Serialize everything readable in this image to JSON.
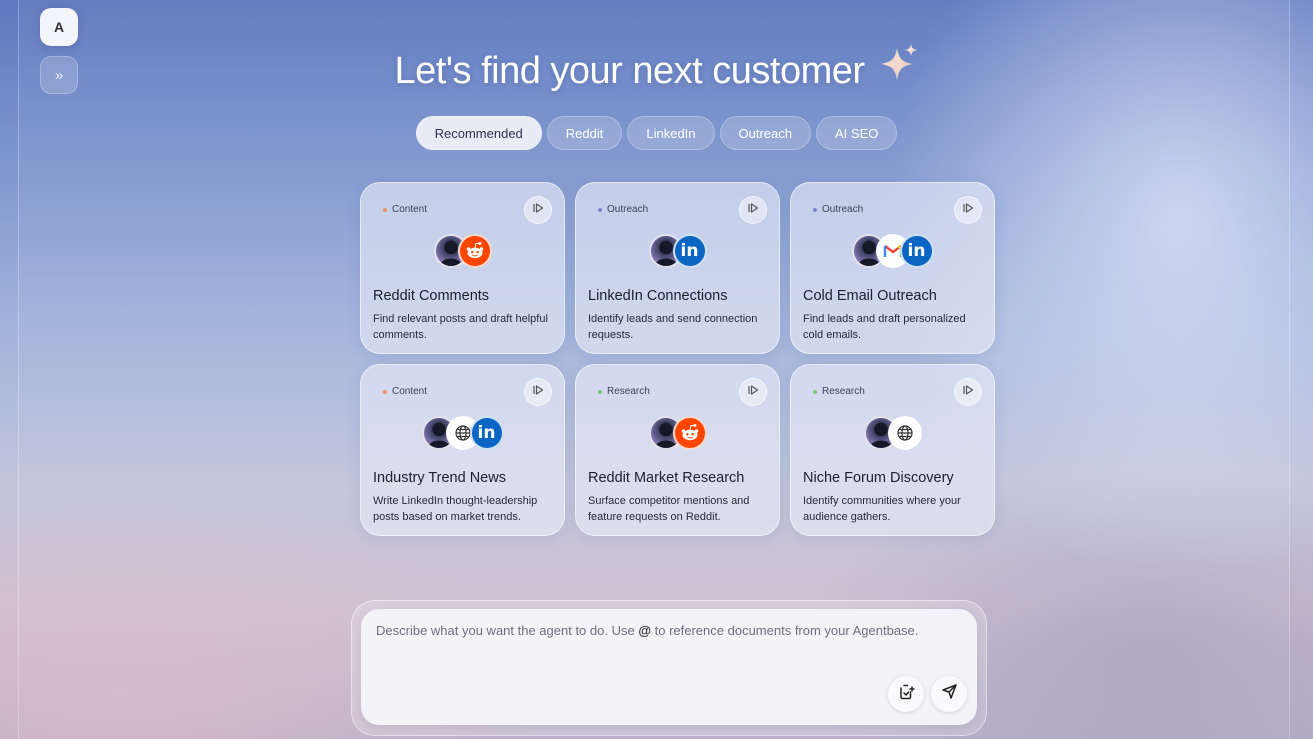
{
  "sidebar": {
    "avatar_initial": "A",
    "expand_glyph": "»"
  },
  "headline": "Let's find your next customer",
  "tabs": [
    {
      "label": "Recommended",
      "active": true
    },
    {
      "label": "Reddit",
      "active": false
    },
    {
      "label": "LinkedIn",
      "active": false
    },
    {
      "label": "Outreach",
      "active": false
    },
    {
      "label": "AI SEO",
      "active": false
    }
  ],
  "cards": [
    {
      "tag": "Content",
      "tag_color": "#f0906a",
      "icons": [
        "person-icon",
        "reddit-icon"
      ],
      "title": "Reddit Comments",
      "desc": "Find relevant posts and draft helpful comments."
    },
    {
      "tag": "Outreach",
      "tag_color": "#7b86c8",
      "icons": [
        "person-icon",
        "linkedin-icon"
      ],
      "title": "LinkedIn Connections",
      "desc": "Identify leads and send connection requests."
    },
    {
      "tag": "Outreach",
      "tag_color": "#7b86c8",
      "icons": [
        "person-icon",
        "gmail-icon",
        "linkedin-icon"
      ],
      "title": "Cold Email Outreach",
      "desc": "Find leads and draft personalized cold emails."
    },
    {
      "tag": "Content",
      "tag_color": "#f0906a",
      "icons": [
        "person-icon",
        "globe-icon",
        "linkedin-icon"
      ],
      "title": "Industry Trend News",
      "desc": "Write LinkedIn thought-leadership posts based on market trends."
    },
    {
      "tag": "Research",
      "tag_color": "#7fbf7f",
      "icons": [
        "person-icon",
        "reddit-icon"
      ],
      "title": "Reddit Market Research",
      "desc": "Surface competitor mentions and feature requests on Reddit."
    },
    {
      "tag": "Research",
      "tag_color": "#7fbf7f",
      "icons": [
        "person-icon",
        "globe-icon"
      ],
      "title": "Niche Forum Discovery",
      "desc": "Identify communities where your audience gathers."
    }
  ],
  "composer": {
    "placeholder_pre": "Describe what you want the agent to do. Use ",
    "placeholder_at": "@",
    "placeholder_post": " to reference documents from your Agentbase."
  },
  "linkedin_text": "in"
}
